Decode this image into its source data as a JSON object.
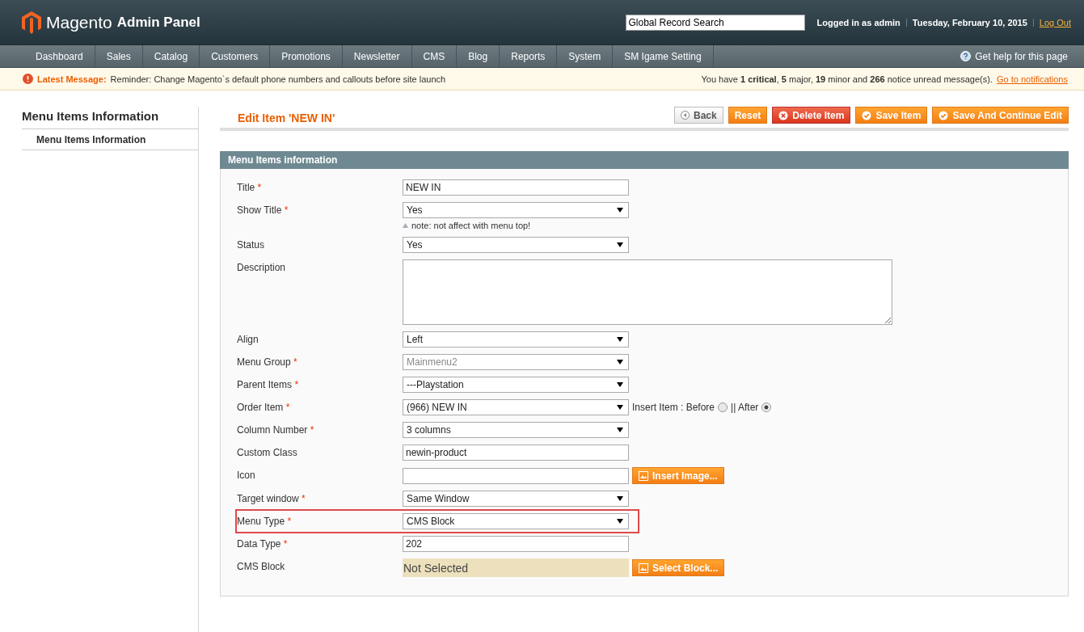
{
  "header": {
    "logo_main": "Magento",
    "logo_sub": "Admin Panel",
    "search": {
      "value": "Global Record Search"
    },
    "user": "Logged in as admin",
    "date": "Tuesday, February 10, 2015",
    "logout": "Log Out"
  },
  "nav": {
    "items": [
      "Dashboard",
      "Sales",
      "Catalog",
      "Customers",
      "Promotions",
      "Newsletter",
      "CMS",
      "Blog",
      "Reports",
      "System",
      "SM Igame Setting"
    ],
    "help": "Get help for this page"
  },
  "message_bar": {
    "label": "Latest Message:",
    "text": "Reminder: Change Magento`s default phone numbers and callouts before site launch",
    "summary": "You have **1 critical**, **5** major, **19** minor and **266** notice unread message(s).",
    "link": "Go to notifications"
  },
  "sidebar": {
    "title": "Menu Items Information",
    "tabs": [
      {
        "label": "Menu Items Information",
        "selected": true
      }
    ]
  },
  "page_title": "Edit Item 'NEW IN'",
  "buttons": [
    {
      "kind": "back",
      "label": "Back"
    },
    {
      "kind": "plain",
      "label": "Reset"
    },
    {
      "kind": "delete",
      "label": "Delete Item"
    },
    {
      "kind": "save",
      "label": "Save Item"
    },
    {
      "kind": "save",
      "label": "Save And Continue Edit"
    }
  ],
  "section_title": "Menu Items information",
  "fields": [
    {
      "label": "Title",
      "required": "*",
      "kind": "text",
      "value": "NEW IN"
    },
    {
      "label": "Show Title",
      "required": "*",
      "kind": "select",
      "value": "Yes",
      "note": "note: not affect with menu top!"
    },
    {
      "label": "Status",
      "kind": "select",
      "value": "Yes"
    },
    {
      "label": "Description",
      "kind": "textarea"
    },
    {
      "label": "Align",
      "kind": "select",
      "value": "Left"
    },
    {
      "label": "Menu Group",
      "required": "*",
      "kind": "select",
      "value": "Mainmenu2",
      "disabled": true
    },
    {
      "label": "Parent Items",
      "required": "*",
      "kind": "select",
      "value": "---Playstation"
    },
    {
      "label": "Order Item",
      "required": "*",
      "kind": "select",
      "value": "(966) NEW IN",
      "positions": [
        {
          "label": "Insert Item : Before",
          "selected": false
        },
        {
          "label": "|| After",
          "selected": true
        }
      ]
    },
    {
      "label": "Column Number",
      "required": "*",
      "kind": "select",
      "value": "3 columns"
    },
    {
      "label": "Custom Class",
      "kind": "text",
      "value": "newin-product"
    },
    {
      "label": "Icon",
      "kind": "text",
      "button": "Insert Image..."
    },
    {
      "label": "Target window",
      "required": "*",
      "kind": "select",
      "value": "Same Window"
    },
    {
      "label": "Menu Type",
      "required": "*",
      "kind": "select",
      "value": "CMS Block",
      "highlighted": true
    },
    {
      "label": "Data Type",
      "required": "*",
      "kind": "text",
      "value": "202"
    },
    {
      "label": "CMS Block",
      "kind": "chooser",
      "value": "Not Selected",
      "button": "Select Block..."
    }
  ]
}
